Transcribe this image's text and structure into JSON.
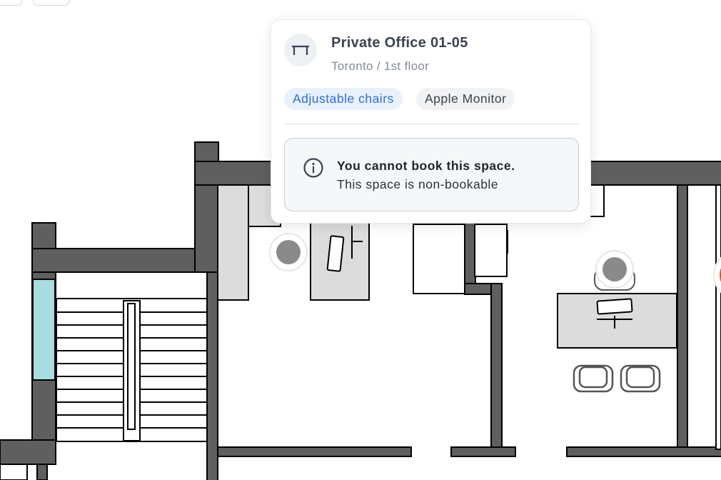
{
  "popover": {
    "icon": "desk-icon",
    "title": "Private Office 01-05",
    "location": "Toronto / 1st floor",
    "amenities": [
      {
        "label": "Adjustable chairs",
        "style": "highlighted",
        "color": "#2f6fd0"
      },
      {
        "label": "Apple Monitor",
        "style": "neutral",
        "color": "#3c424a"
      }
    ],
    "notice": {
      "icon": "info-icon",
      "title": "You cannot book this space.",
      "message": "This space is non-bookable"
    }
  },
  "floorplan": {
    "wall_color": "#5f5f5f",
    "furniture_color": "#dcdcdc",
    "window_color": "#a8dde0",
    "seat_marker_color": "#8a8a8a",
    "partial_marker_color": "#d35a1a"
  }
}
